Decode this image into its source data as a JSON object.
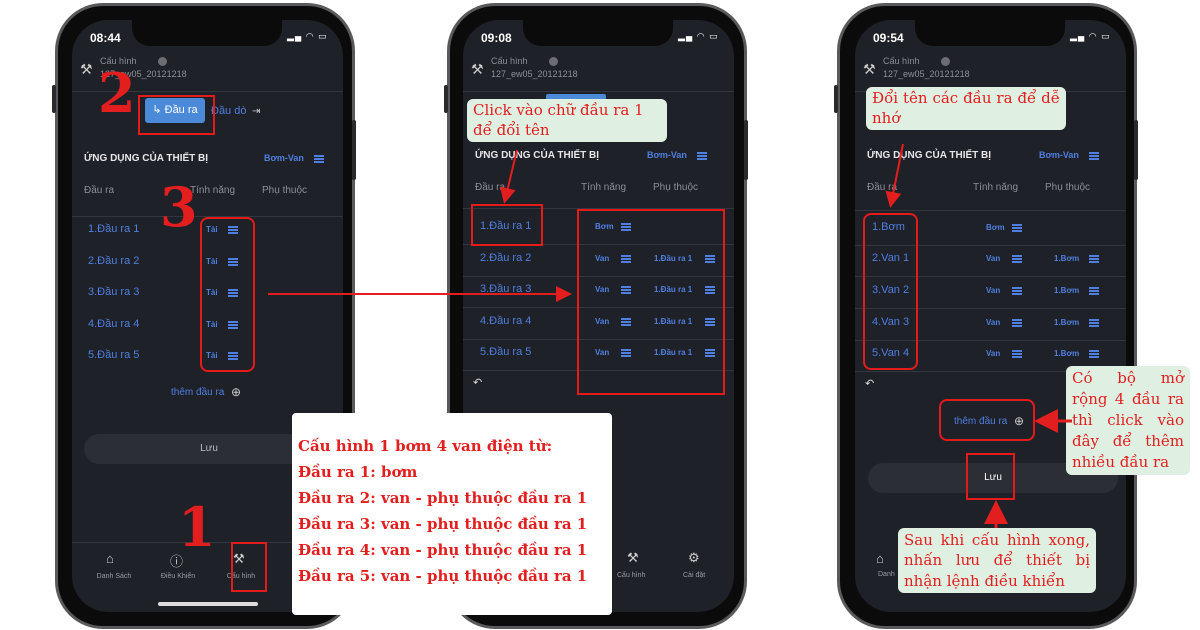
{
  "phones": [
    {
      "time": "08:44",
      "header_title": "Cấu hình",
      "device_id": "127_ew05_20121218",
      "tab_output": "Đầu ra",
      "tab_sensor": "Đầu dò",
      "section_title": "ỨNG DỤNG CỦA THIẾT BỊ",
      "app_type": "Bơm-Van",
      "col_output": "Đầu ra",
      "col_feature": "Tính năng",
      "col_depend": "Phụ thuộc",
      "rows": [
        {
          "name": "1.Đầu ra 1",
          "feature": "Tải",
          "depend": ""
        },
        {
          "name": "2.Đầu ra 2",
          "feature": "Tải",
          "depend": ""
        },
        {
          "name": "3.Đầu ra 3",
          "feature": "Tải",
          "depend": ""
        },
        {
          "name": "4.Đầu ra 4",
          "feature": "Tải",
          "depend": ""
        },
        {
          "name": "5.Đầu ra 5",
          "feature": "Tải",
          "depend": ""
        }
      ],
      "add_output": "thêm đầu ra",
      "save": "Lưu",
      "nav": [
        "Danh Sách",
        "Điều Khiển",
        "Cấu hình"
      ]
    },
    {
      "time": "09:08",
      "header_title": "Cấu hình",
      "device_id": "127_ew05_20121218",
      "section_title": "ỨNG DỤNG CỦA THIẾT BỊ",
      "app_type": "Bơm-Van",
      "col_output": "Đầu ra",
      "col_feature": "Tính năng",
      "col_depend": "Phụ thuộc",
      "rows": [
        {
          "name": "1.Đầu ra 1",
          "feature": "Bơm",
          "depend": ""
        },
        {
          "name": "2.Đầu ra 2",
          "feature": "Van",
          "depend": "1.Đầu ra 1"
        },
        {
          "name": "3.Đầu ra 3",
          "feature": "Van",
          "depend": "1.Đầu ra 1"
        },
        {
          "name": "4.Đầu ra 4",
          "feature": "Van",
          "depend": "1.Đầu ra 1"
        },
        {
          "name": "5.Đầu ra 5",
          "feature": "Van",
          "depend": "1.Đầu ra 1"
        }
      ],
      "nav": [
        "Cấu hình",
        "Cài đặt"
      ]
    },
    {
      "time": "09:54",
      "header_title": "Cấu hình",
      "device_id": "127_ew05_20121218",
      "section_title": "ỨNG DỤNG CỦA THIẾT BỊ",
      "app_type": "Bơm-Van",
      "col_output": "Đầu ra",
      "col_feature": "Tính năng",
      "col_depend": "Phụ thuộc",
      "rows": [
        {
          "name": "1.Bơm",
          "feature": "Bơm",
          "depend": ""
        },
        {
          "name": "2.Van 1",
          "feature": "Van",
          "depend": "1.Bơm"
        },
        {
          "name": "3.Van 2",
          "feature": "Van",
          "depend": "1.Bơm"
        },
        {
          "name": "4.Van 3",
          "feature": "Van",
          "depend": "1.Bơm"
        },
        {
          "name": "5.Van 4",
          "feature": "Van",
          "depend": "1.Bơm"
        }
      ],
      "add_output": "thêm đầu ra",
      "save": "Lưu",
      "nav": [
        "Danh"
      ]
    }
  ],
  "annotations": {
    "step1": "1",
    "step2": "2",
    "step3": "3",
    "rename_hint": "Click vào chữ đầu ra 1 để đổi tên",
    "rename_tip": "Đổi tên các đầu ra để dễ nhớ",
    "expand_tip": "Có bộ mở rộng 4 đầu ra thì click vào đây để thêm nhiều đầu ra",
    "save_tip": "Sau khi cấu hình xong, nhấn lưu để thiết bị nhận lệnh điều khiển",
    "config_title": "Cấu hình 1 bơm 4 van điện từ:",
    "config_lines": [
      "Đầu ra 1: bơm",
      "Đầu ra 2: van - phụ thuộc đầu ra 1",
      "Đầu ra 3: van - phụ thuộc đầu ra 1",
      "Đầu ra 4: van - phụ thuộc đầu ra 1",
      "Đầu ra 5: van - phụ thuộc đầu ra 1"
    ]
  },
  "colors": {
    "accent": "#4f7fe0",
    "annotation_red": "#e31e1e",
    "note_bg": "#dff0e3",
    "screen_bg": "#1f2128"
  }
}
